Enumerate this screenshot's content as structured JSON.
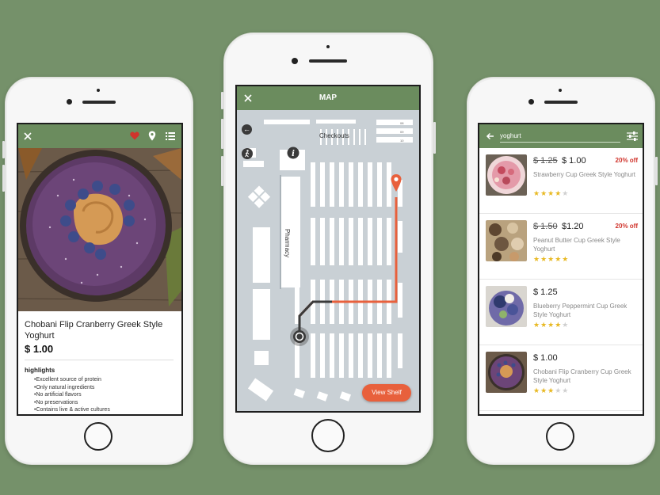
{
  "colors": {
    "background": "#75916a",
    "header": "#6b8c5e",
    "accent": "#e8603c",
    "discount": "#d0342c",
    "star": "#e8b923"
  },
  "product": {
    "title": "Chobani Flip Cranberry Greek Style Yoghurt",
    "price": "$ 1.00",
    "highlights_label": "highlights",
    "highlights": [
      "Excellent source of protein",
      "Only natural ingredients",
      "No artificial flavors",
      "No preservations",
      "Contains live & active cultures"
    ],
    "icons": [
      "close-icon",
      "heart-icon",
      "location-pin-icon",
      "list-icon"
    ]
  },
  "map": {
    "title": "MAP",
    "checkouts_label": "Checkouts",
    "pharmacy_label": "Pharmacy",
    "view_shelf_label": "View Shelf",
    "icons": [
      "close-icon",
      "back-arrow-icon",
      "walking-person-icon",
      "info-icon",
      "location-pin-icon",
      "current-location-icon"
    ]
  },
  "search": {
    "query": "yoghurt",
    "icons": [
      "back-arrow-icon",
      "filter-icon"
    ],
    "results": [
      {
        "old_price": "$ 1.25",
        "price": "$ 1.00",
        "discount": "20% off",
        "name": "Strawberry Cup Greek Style Yoghurt",
        "rating": 4
      },
      {
        "old_price": "$ 1.50",
        "price": "$1.20",
        "discount": "20% off",
        "name": "Peanut Butter Cup Greek Style Yoghurt",
        "rating": 5
      },
      {
        "old_price": "",
        "price": "$ 1.25",
        "discount": "",
        "name": "Blueberry Peppermint Cup Greek Style Yoghurt",
        "rating": 4
      },
      {
        "old_price": "",
        "price": "$ 1.00",
        "discount": "",
        "name": "Chobani Flip Cranberry Cup Greek Style Yoghurt",
        "rating": 3
      }
    ]
  }
}
